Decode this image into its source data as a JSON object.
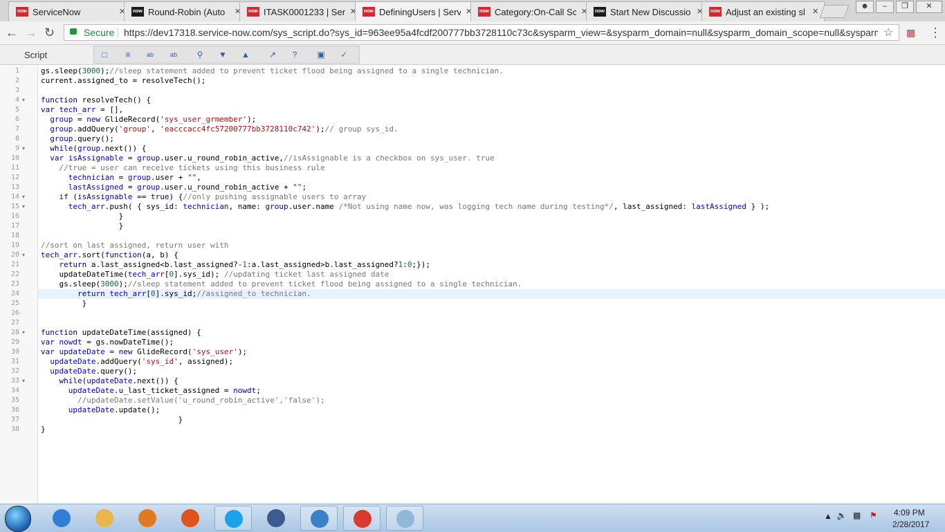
{
  "browser": {
    "tabs": [
      {
        "title": "ServiceNow",
        "favicon": "now",
        "favicon_color": "#d9262b"
      },
      {
        "title": "Round-Robin (Auto",
        "favicon": "now",
        "favicon_color": "#1a1a1a"
      },
      {
        "title": "ITASK0001233 | Serv",
        "favicon": "now",
        "favicon_color": "#d9262b"
      },
      {
        "title": "DefiningUsers | Serv",
        "favicon": "now",
        "favicon_color": "#d9262b",
        "active": true
      },
      {
        "title": "Category:On-Call Sc",
        "favicon": "now",
        "favicon_color": "#d9262b"
      },
      {
        "title": "Start New Discussio",
        "favicon": "now",
        "favicon_color": "#1a1a1a"
      },
      {
        "title": "Adjust an existing sl",
        "favicon": "now",
        "favicon_color": "#d9262b"
      }
    ],
    "close_glyph": "×",
    "secure_label": "Secure",
    "url": "https://dev17318.service-now.com/sys_script.do?sys_id=963ee95a4fcdf200777bb3728110c73c&sysparm_view=&sysparm_domain=null&sysparm_domain_scope=null&sysparm_",
    "back_glyph": "←",
    "forward_glyph": "→",
    "reload_glyph": "↻",
    "star_glyph": "☆",
    "menu_glyph": "⋮"
  },
  "script_toolbar": {
    "label": "Script",
    "buttons": [
      "comment-icon",
      "format-icon",
      "replace-icon",
      "replace-all-icon",
      "search-icon",
      "next-icon",
      "previous-icon",
      "fullscreen-icon",
      "help-icon",
      "save-icon",
      "syntax-check-icon"
    ]
  },
  "editor": {
    "lines": [
      {
        "n": "1",
        "fold": "",
        "tokens": [
          [
            "",
            "gs.sleep("
          ],
          [
            "num",
            "3000"
          ],
          [
            "",
            ");"
          ],
          [
            "com",
            "//sleep statement added to prevent ticket flood being assigned to a single technician."
          ]
        ]
      },
      {
        "n": "2",
        "fold": "",
        "tokens": [
          [
            "",
            "current.assigned_to = resolveTech();"
          ]
        ]
      },
      {
        "n": "3",
        "fold": "",
        "tokens": [
          [
            "",
            ""
          ]
        ]
      },
      {
        "n": "4",
        "fold": "▾",
        "tokens": [
          [
            "kw",
            "function"
          ],
          [
            "",
            " resolveTech() {"
          ]
        ]
      },
      {
        "n": "5",
        "fold": "",
        "tokens": [
          [
            "kw",
            "var"
          ],
          [
            "",
            " "
          ],
          [
            "var",
            "tech_arr"
          ],
          [
            "",
            " = [],"
          ]
        ]
      },
      {
        "n": "6",
        "fold": "",
        "tokens": [
          [
            "",
            "  "
          ],
          [
            "var",
            "group"
          ],
          [
            "",
            " = "
          ],
          [
            "kw",
            "new"
          ],
          [
            "",
            " GlideRecord("
          ],
          [
            "str",
            "'sys_user_grmember'"
          ],
          [
            "",
            ");"
          ]
        ]
      },
      {
        "n": "7",
        "fold": "",
        "tokens": [
          [
            "",
            "  "
          ],
          [
            "var",
            "group"
          ],
          [
            "",
            ".addQuery("
          ],
          [
            "str",
            "'group'"
          ],
          [
            "",
            ", "
          ],
          [
            "str",
            "'eacccacc4fc57200777bb3728110c742'"
          ],
          [
            "",
            ");"
          ],
          [
            "com",
            "// group sys_id."
          ]
        ]
      },
      {
        "n": "8",
        "fold": "",
        "tokens": [
          [
            "",
            "  "
          ],
          [
            "var",
            "group"
          ],
          [
            "",
            ".query();"
          ]
        ]
      },
      {
        "n": "9",
        "fold": "▾",
        "tokens": [
          [
            "",
            "  "
          ],
          [
            "kw",
            "while"
          ],
          [
            "",
            "("
          ],
          [
            "var",
            "group"
          ],
          [
            "",
            ".next()) {"
          ]
        ]
      },
      {
        "n": "10",
        "fold": "",
        "tokens": [
          [
            "",
            "  "
          ],
          [
            "kw",
            "var"
          ],
          [
            "",
            " "
          ],
          [
            "var",
            "isAssignable"
          ],
          [
            "",
            " = "
          ],
          [
            "var",
            "group"
          ],
          [
            "",
            ".user.u_round_robin_active,"
          ],
          [
            "com",
            "//isAssignable is a checkbox on sys_user. true"
          ]
        ]
      },
      {
        "n": "11",
        "fold": "",
        "tokens": [
          [
            "com",
            "    //true = user can receive tickets using this business rule"
          ]
        ]
      },
      {
        "n": "12",
        "fold": "",
        "tokens": [
          [
            "",
            "      "
          ],
          [
            "var",
            "technician"
          ],
          [
            "",
            " = "
          ],
          [
            "var",
            "group"
          ],
          [
            "",
            ".user + "
          ],
          [
            "str",
            "\"\""
          ],
          [
            "",
            ","
          ]
        ]
      },
      {
        "n": "13",
        "fold": "",
        "tokens": [
          [
            "",
            "      "
          ],
          [
            "var",
            "lastAssigned"
          ],
          [
            "",
            " = "
          ],
          [
            "var",
            "group"
          ],
          [
            "",
            ".user.u_round_robin_active + "
          ],
          [
            "str",
            "\"\""
          ],
          [
            "",
            ";"
          ]
        ]
      },
      {
        "n": "14",
        "fold": "▾",
        "tokens": [
          [
            "",
            "    "
          ],
          [
            "kw",
            "if"
          ],
          [
            "",
            " ("
          ],
          [
            "var",
            "isAssignable"
          ],
          [
            "",
            " == "
          ],
          [
            "kw",
            "true"
          ],
          [
            "",
            ") {"
          ],
          [
            "com",
            "//only pushing assignable users to array"
          ]
        ]
      },
      {
        "n": "15",
        "fold": "▾",
        "tokens": [
          [
            "",
            "      "
          ],
          [
            "var",
            "tech_arr"
          ],
          [
            "",
            ".push( { sys_id: "
          ],
          [
            "var",
            "technician"
          ],
          [
            "",
            ", name: "
          ],
          [
            "var",
            "group"
          ],
          [
            "",
            ".user.name "
          ],
          [
            "com",
            "/*Not using name now, was logging tech name during testing*/"
          ],
          [
            "",
            ", last_assigned: "
          ],
          [
            "var",
            "lastAssigned"
          ],
          [
            "",
            " } );"
          ]
        ]
      },
      {
        "n": "16",
        "fold": "",
        "tokens": [
          [
            "",
            "                 }"
          ]
        ]
      },
      {
        "n": "17",
        "fold": "",
        "tokens": [
          [
            "",
            "                 }"
          ]
        ]
      },
      {
        "n": "18",
        "fold": "",
        "tokens": [
          [
            "",
            ""
          ]
        ]
      },
      {
        "n": "19",
        "fold": "",
        "tokens": [
          [
            "com",
            "//sort on last assigned, return user with"
          ]
        ]
      },
      {
        "n": "20",
        "fold": "▾",
        "tokens": [
          [
            "var",
            "tech_arr"
          ],
          [
            "",
            ".sort("
          ],
          [
            "kw",
            "function"
          ],
          [
            "",
            "(a, b) {"
          ]
        ]
      },
      {
        "n": "21",
        "fold": "",
        "tokens": [
          [
            "",
            "    "
          ],
          [
            "kw",
            "return"
          ],
          [
            "",
            " a.last_assigned<b.last_assigned?-"
          ],
          [
            "num",
            "1"
          ],
          [
            "",
            ":a.last_assigned>b.last_assigned?"
          ],
          [
            "num",
            "1"
          ],
          [
            "",
            ":"
          ],
          [
            "num",
            "0"
          ],
          [
            "",
            ";});"
          ]
        ]
      },
      {
        "n": "22",
        "fold": "",
        "tokens": [
          [
            "",
            "    updateDateTime("
          ],
          [
            "var",
            "tech_arr"
          ],
          [
            "",
            "["
          ],
          [
            "num",
            "0"
          ],
          [
            "",
            "].sys_id); "
          ],
          [
            "com",
            "//updating ticket last assigned date"
          ]
        ]
      },
      {
        "n": "23",
        "fold": "",
        "tokens": [
          [
            "",
            "    gs.sleep("
          ],
          [
            "num",
            "3000"
          ],
          [
            "",
            ");"
          ],
          [
            "com",
            "//sleep statement added to prevent ticket flood being assigned to a single technician."
          ]
        ]
      },
      {
        "n": "24",
        "fold": "",
        "tokens": [
          [
            "",
            "        "
          ],
          [
            "kw",
            "return"
          ],
          [
            "",
            " "
          ],
          [
            "var",
            "tech_arr"
          ],
          [
            "",
            "["
          ],
          [
            "num",
            "0"
          ],
          [
            "",
            "].sys_id;"
          ],
          [
            "com",
            "//assigned_to technician."
          ]
        ]
      },
      {
        "n": "25",
        "fold": "",
        "tokens": [
          [
            "",
            "         }"
          ]
        ]
      },
      {
        "n": "26",
        "fold": "",
        "tokens": [
          [
            "",
            ""
          ]
        ]
      },
      {
        "n": "27",
        "fold": "",
        "tokens": [
          [
            "",
            ""
          ]
        ]
      },
      {
        "n": "28",
        "fold": "▾",
        "tokens": [
          [
            "kw",
            "function"
          ],
          [
            "",
            " updateDateTime(assigned) {"
          ]
        ]
      },
      {
        "n": "29",
        "fold": "",
        "tokens": [
          [
            "kw",
            "var"
          ],
          [
            "",
            " "
          ],
          [
            "var",
            "nowdt"
          ],
          [
            "",
            " = gs.nowDateTime();"
          ]
        ]
      },
      {
        "n": "30",
        "fold": "",
        "tokens": [
          [
            "kw",
            "var"
          ],
          [
            "",
            " "
          ],
          [
            "var",
            "updateDate"
          ],
          [
            "",
            " = "
          ],
          [
            "kw",
            "new"
          ],
          [
            "",
            " GlideRecord("
          ],
          [
            "str",
            "'sys_user'"
          ],
          [
            "",
            ");"
          ]
        ]
      },
      {
        "n": "31",
        "fold": "",
        "tokens": [
          [
            "",
            "  "
          ],
          [
            "var",
            "updateDate"
          ],
          [
            "",
            ".addQuery("
          ],
          [
            "str",
            "'sys_id'"
          ],
          [
            "",
            ", assigned);"
          ]
        ]
      },
      {
        "n": "32",
        "fold": "",
        "tokens": [
          [
            "",
            "  "
          ],
          [
            "var",
            "updateDate"
          ],
          [
            "",
            ".query();"
          ]
        ]
      },
      {
        "n": "33",
        "fold": "▾",
        "tokens": [
          [
            "",
            "    "
          ],
          [
            "kw",
            "while"
          ],
          [
            "",
            "("
          ],
          [
            "var",
            "updateDate"
          ],
          [
            "",
            ".next()) {"
          ]
        ]
      },
      {
        "n": "34",
        "fold": "",
        "tokens": [
          [
            "",
            "      "
          ],
          [
            "var",
            "updateDate"
          ],
          [
            "",
            ".u_last_ticket_assigned = "
          ],
          [
            "var",
            "nowdt"
          ],
          [
            "",
            ";"
          ]
        ]
      },
      {
        "n": "35",
        "fold": "",
        "tokens": [
          [
            "com",
            "        //updateDate.setValue('u_round_robin_active','false');"
          ]
        ]
      },
      {
        "n": "36",
        "fold": "",
        "tokens": [
          [
            "",
            "      "
          ],
          [
            "var",
            "updateDate"
          ],
          [
            "",
            ".update();"
          ]
        ]
      },
      {
        "n": "37",
        "fold": "",
        "tokens": [
          [
            "",
            "                              }"
          ]
        ]
      },
      {
        "n": "38",
        "fold": "",
        "tokens": [
          [
            "",
            "}"
          ]
        ]
      }
    ]
  },
  "taskbar": {
    "apps": [
      {
        "name": "ie-icon",
        "color": "#2f7fd6"
      },
      {
        "name": "explorer-icon",
        "color": "#e8b64a"
      },
      {
        "name": "media-player-icon",
        "color": "#e07a1f"
      },
      {
        "name": "firefox-icon",
        "color": "#e0541b"
      },
      {
        "name": "skype-icon",
        "color": "#1aa3e8"
      },
      {
        "name": "thunderbird-icon",
        "color": "#3c5a8c"
      },
      {
        "name": "lync-icon",
        "color": "#3b7fc4"
      },
      {
        "name": "chrome-icon",
        "color": "#d93a2b"
      },
      {
        "name": "notepad-icon",
        "color": "#8fb8d8"
      }
    ],
    "time": "4:09 PM",
    "date": "2/28/2017"
  }
}
